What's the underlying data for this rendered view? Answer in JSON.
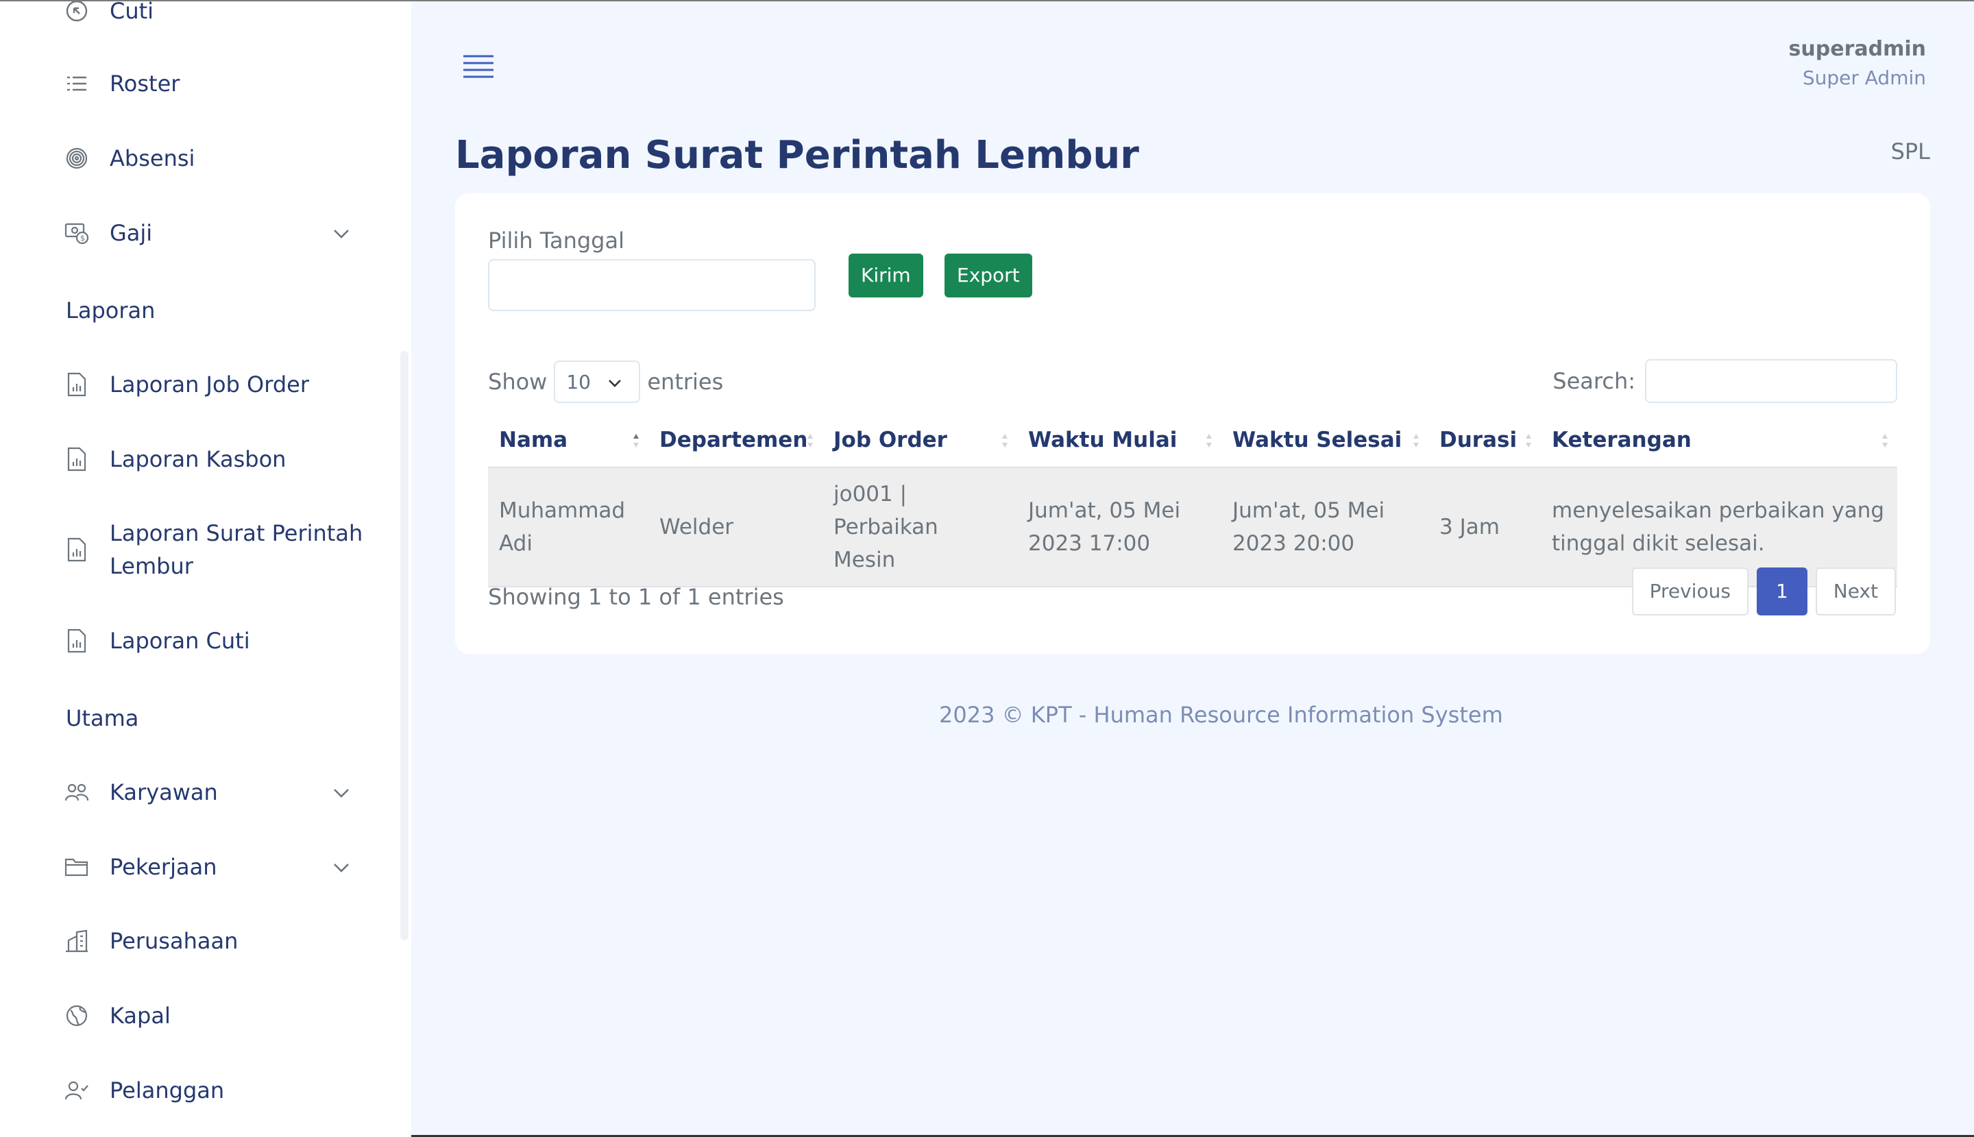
{
  "sidebar": {
    "items_top": [
      {
        "label": "Cuti",
        "icon": "arrow-circle-icon"
      },
      {
        "label": "Roster",
        "icon": "list-icon"
      },
      {
        "label": "Absensi",
        "icon": "fingerprint-icon"
      },
      {
        "label": "Gaji",
        "icon": "cash-icon",
        "expandable": true
      }
    ],
    "section_laporan": "Laporan",
    "items_laporan": [
      {
        "label": "Laporan Job Order",
        "icon": "report-file-icon"
      },
      {
        "label": "Laporan Kasbon",
        "icon": "report-file-icon"
      },
      {
        "label": "Laporan Surat Perintah Lembur",
        "icon": "report-file-icon"
      },
      {
        "label": "Laporan Cuti",
        "icon": "report-file-icon"
      }
    ],
    "section_utama": "Utama",
    "items_utama": [
      {
        "label": "Karyawan",
        "icon": "people-icon",
        "expandable": true
      },
      {
        "label": "Pekerjaan",
        "icon": "folder-icon",
        "expandable": true
      },
      {
        "label": "Perusahaan",
        "icon": "building-icon"
      },
      {
        "label": "Kapal",
        "icon": "globe-icon"
      },
      {
        "label": "Pelanggan",
        "icon": "person-check-icon"
      }
    ]
  },
  "header": {
    "username": "superadmin",
    "role": "Super Admin"
  },
  "page": {
    "title": "Laporan Surat Perintah Lembur",
    "breadcrumb": "SPL"
  },
  "form": {
    "date_label": "Pilih Tanggal",
    "date_value": "",
    "submit_label": "Kirim",
    "export_label": "Export"
  },
  "table_controls": {
    "show_label": "Show",
    "length_value": "10",
    "entries_label": "entries",
    "search_label": "Search:",
    "search_value": ""
  },
  "table": {
    "columns": [
      "Nama",
      "Departemen",
      "Job Order",
      "Waktu Mulai",
      "Waktu Selesai",
      "Durasi",
      "Keterangan"
    ],
    "rows": [
      [
        "Muhammad Adi",
        "Welder",
        "jo001 | Perbaikan Mesin",
        "Jum'at, 05 Mei 2023 17:00",
        "Jum'at, 05 Mei 2023 20:00",
        "3 Jam",
        "menyelesaikan perbaikan yang tinggal dikit selesai."
      ]
    ]
  },
  "pagination": {
    "info": "Showing 1 to 1 of 1 entries",
    "previous": "Previous",
    "current": "1",
    "next": "Next"
  },
  "footer": {
    "text": "2023 © KPT - Human Resource Information System"
  },
  "colors": {
    "primary": "#435ebe",
    "success": "#198754",
    "heading": "#25396f",
    "background": "#f2f7ff"
  }
}
